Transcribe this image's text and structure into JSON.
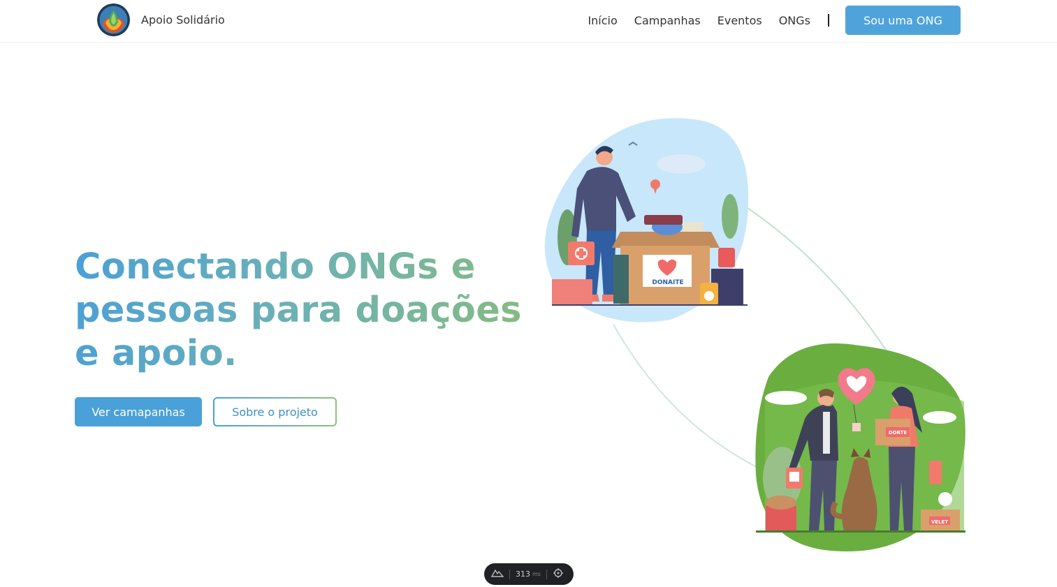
{
  "header": {
    "brand_name": "Apoio Solidário",
    "nav": [
      "Início",
      "Campanhas",
      "Eventos",
      "ONGs"
    ],
    "cta_label": "Sou uma ONG"
  },
  "hero": {
    "title": "Conectando ONGs e pessoas para doações e apoio.",
    "primary_button": "Ver camapanhas",
    "secondary_button": "Sobre o projeto"
  },
  "illustration": {
    "box_label_1": "DONAITE",
    "box_label_2": "DORTE",
    "box_label_3": "VELET"
  },
  "devtools": {
    "timing_value": "313",
    "timing_unit": "ms"
  },
  "colors": {
    "accent_blue": "#4fa3db",
    "accent_green": "#86bb82",
    "blob_blue": "#c9e7fa",
    "blob_green": "#6aae3f"
  }
}
